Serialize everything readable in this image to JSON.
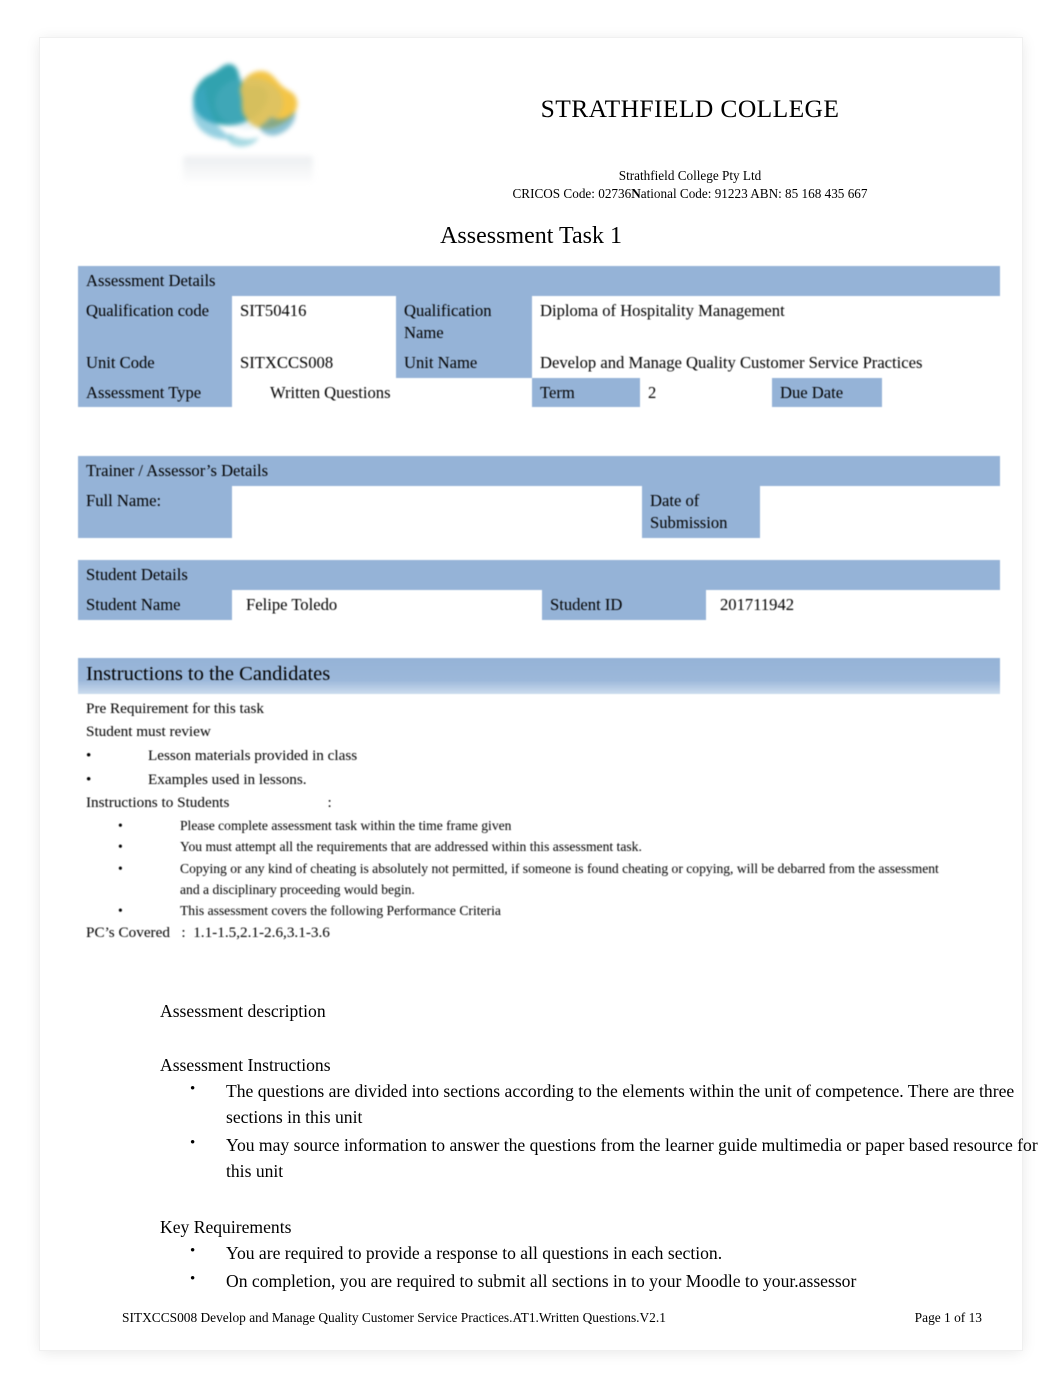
{
  "header": {
    "logo_icon": "strathfield-australia-logo",
    "college_name": "STRATHFIELD COLLEGE",
    "legal_name": "Strathfield College Pty Ltd",
    "cricos_prefix": "CRICOS Code: 02736",
    "cricos_bold_letter": "N",
    "cricos_suffix": "ational Code: 91223 ABN: 85 168 435 667"
  },
  "doc": {
    "title": "Assessment Task 1"
  },
  "assessment_details": {
    "band_label": "Assessment Details",
    "qualification_code_label": "Qualification code",
    "qualification_code_value": "SIT50416",
    "qualification_name_label": "Qualification Name",
    "qualification_name_value": "Diploma of Hospitality Management",
    "unit_code_label": "Unit Code",
    "unit_code_value": "SITXCCS008",
    "unit_name_label": "Unit Name",
    "unit_name_value": "Develop and Manage Quality Customer Service Practices",
    "assessment_type_label": "Assessment Type",
    "assessment_type_value": "Written Questions",
    "term_label": "Term",
    "term_value": "2",
    "due_date_label": "Due Date",
    "due_date_value": ""
  },
  "trainer_details": {
    "band_label": "Trainer / Assessor’s Details",
    "full_name_label": "Full Name:",
    "full_name_value": "",
    "date_of_submission_label": "Date of Submission",
    "date_of_submission_value": ""
  },
  "student_details": {
    "band_label": "Student Details",
    "student_name_label": "Student Name",
    "student_name_value": "Felipe Toledo",
    "student_id_label": "Student ID",
    "student_id_value": "201711942"
  },
  "instructions": {
    "band_label": "Instructions to the Candidates",
    "pre_requirement_line": "Pre Requirement for this task",
    "student_must_review_line": "Student must review",
    "review_items": [
      "Lesson materials provided in class",
      "Examples used in lessons."
    ],
    "instructions_to_students_label": "Instructions to Students",
    "instructions_to_students_colon": ":",
    "student_items": [
      "Please complete assessment task within the time frame given",
      "You must attempt all the requirements that are addressed within this assessment task.",
      "Copying or any kind of cheating is absolutely not permitted, if someone is found cheating or copying, will be debarred from the assessment and a disciplinary proceeding would begin.",
      "This assessment covers the following Performance Criteria"
    ],
    "pc_covered_label": "PC’s Covered",
    "pc_covered_colon": ":",
    "pc_covered_value": "1.1-1.5,2.1-2.6,3.1-3.6"
  },
  "body": {
    "assessment_description_heading": "Assessment description",
    "assessment_instructions_heading": "Assessment Instructions",
    "assessment_instructions_items": [
      "The questions are divided into sections according to the elements within the unit of competence. There are three sections in this unit",
      "You may source information to answer the questions from the learner guide multimedia or paper based resource for this unit"
    ],
    "key_requirements_heading": "Key Requirements",
    "key_requirements_items": [
      "You are required to provide a response to all questions in each section.",
      "On completion, you are required to submit all sections in to your Moodle to your.assessor"
    ]
  },
  "footer": {
    "left": "SITXCCS008 Develop and Manage Quality Customer Service Practices.AT1.Written Questions.V2.1",
    "right": "Page 1 of 13"
  },
  "colors": {
    "table_header_blue": "#95b3d7",
    "page_background": "#ffffff",
    "text": "#000000"
  }
}
